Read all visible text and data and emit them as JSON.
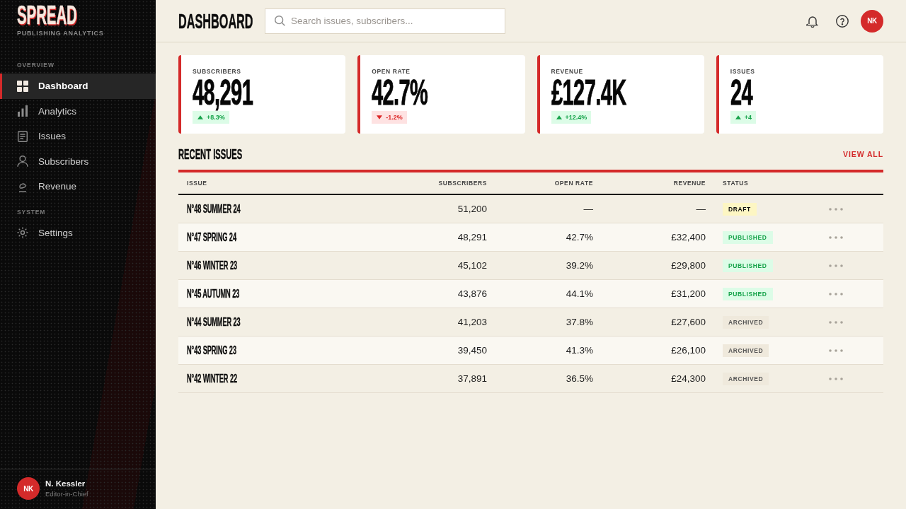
{
  "sidebar": {
    "logo": "SPREAD",
    "tagline": "PUBLISHING ANALYTICS",
    "sections": [
      {
        "heading": "OVERVIEW",
        "items": [
          {
            "label": "Dashboard",
            "selected": true
          },
          {
            "label": "Analytics",
            "selected": false
          },
          {
            "label": "Issues",
            "selected": false
          },
          {
            "label": "Subscribers",
            "selected": false
          },
          {
            "label": "Revenue",
            "selected": false
          }
        ]
      },
      {
        "heading": "SYSTEM",
        "items": [
          {
            "label": "Settings",
            "selected": false
          }
        ]
      }
    ],
    "user": {
      "initials": "NK",
      "name": "N. Kessler",
      "role": "Editor-in-Chief"
    }
  },
  "header": {
    "title": "DASHBOARD",
    "search": {
      "placeholder": "Search issues, subscribers..."
    },
    "avatar": "NK"
  },
  "stats": [
    {
      "label": "SUBSCRIBERS",
      "value": "48,291",
      "change": {
        "text": "+8.3%",
        "kind": "up"
      }
    },
    {
      "label": "OPEN RATE",
      "value": "42.7%",
      "change": {
        "text": "-1.2%",
        "kind": "down"
      }
    },
    {
      "label": "REVENUE",
      "value": "£127.4K",
      "change": {
        "text": "+12.4%",
        "kind": "up"
      }
    },
    {
      "label": "ISSUES",
      "value": "24",
      "change": {
        "text": "+4",
        "kind": "up"
      }
    }
  ],
  "recent_issues": {
    "title": "RECENT ISSUES",
    "link": "VIEW ALL",
    "columns": [
      "ISSUE",
      "SUBSCRIBERS",
      "OPEN RATE",
      "REVENUE",
      "STATUS"
    ],
    "rows": [
      {
        "issue": "N°48 SUMMER 24",
        "subscribers": "51,200",
        "open_rate": "—",
        "revenue": "—",
        "status": {
          "label": "DRAFT",
          "kind": "draft"
        }
      },
      {
        "issue": "N°47 SPRING 24",
        "subscribers": "48,291",
        "open_rate": "42.7%",
        "revenue": "£32,400",
        "status": {
          "label": "PUBLISHED",
          "kind": "published"
        }
      },
      {
        "issue": "N°46 WINTER 23",
        "subscribers": "45,102",
        "open_rate": "39.2%",
        "revenue": "£29,800",
        "status": {
          "label": "PUBLISHED",
          "kind": "published"
        }
      },
      {
        "issue": "N°45 AUTUMN 23",
        "subscribers": "43,876",
        "open_rate": "44.1%",
        "revenue": "£31,200",
        "status": {
          "label": "PUBLISHED",
          "kind": "published"
        }
      },
      {
        "issue": "N°44 SUMMER 23",
        "subscribers": "41,203",
        "open_rate": "37.8%",
        "revenue": "£27,600",
        "status": {
          "label": "ARCHIVED",
          "kind": "archived"
        }
      },
      {
        "issue": "N°43 SPRING 23",
        "subscribers": "39,450",
        "open_rate": "41.3%",
        "revenue": "£26,100",
        "status": {
          "label": "ARCHIVED",
          "kind": "archived"
        }
      },
      {
        "issue": "N°42 WINTER 22",
        "subscribers": "37,891",
        "open_rate": "36.5%",
        "revenue": "£24,300",
        "status": {
          "label": "ARCHIVED",
          "kind": "archived"
        }
      }
    ]
  }
}
